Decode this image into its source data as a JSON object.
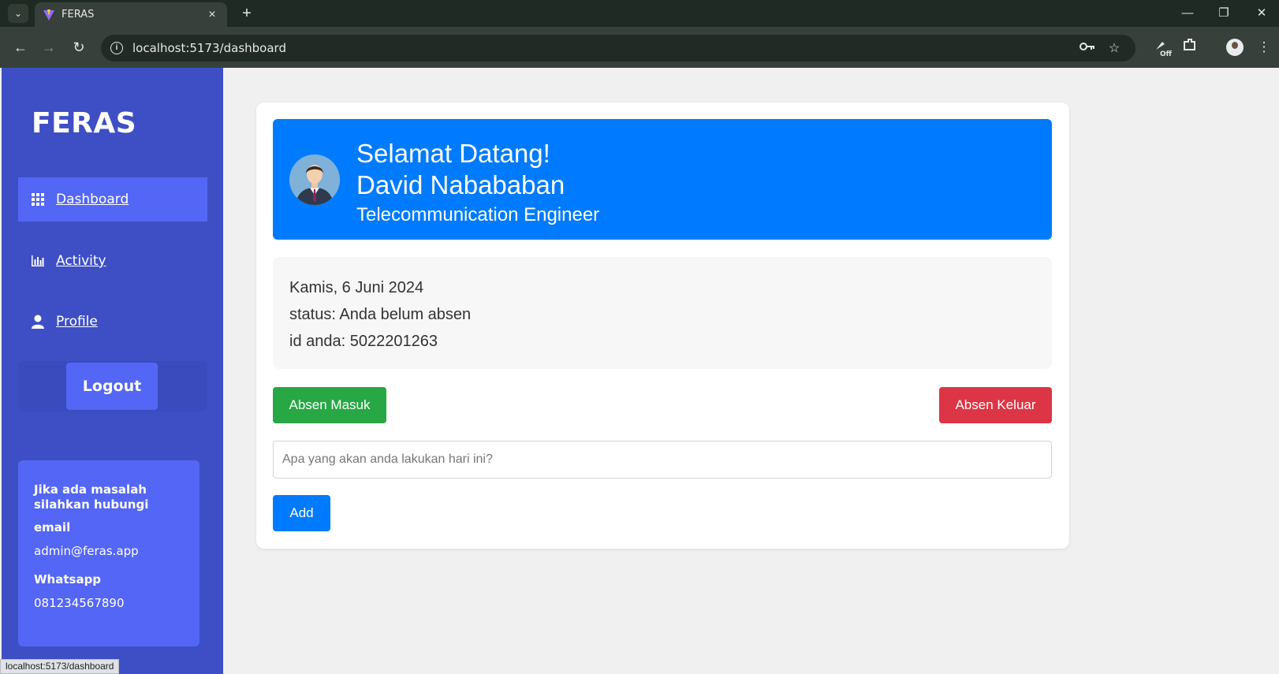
{
  "browser": {
    "tab_title": "FERAS",
    "url": "localhost:5173/dashboard",
    "status_url": "localhost:5173/dashboard",
    "extension_badge": "Off"
  },
  "sidebar": {
    "brand": "FERAS",
    "items": [
      {
        "label": "Dashboard",
        "icon": "grid-icon",
        "active": true
      },
      {
        "label": "Activity",
        "icon": "bar-chart-icon",
        "active": false
      },
      {
        "label": "Profile",
        "icon": "user-icon",
        "active": false
      }
    ],
    "logout_label": "Logout",
    "help": {
      "title": "Jika ada masalah silahkan hubungi",
      "email_label": "email",
      "email_value": "admin@feras.app",
      "whatsapp_label": "Whatsapp",
      "whatsapp_value": "081234567890"
    }
  },
  "welcome": {
    "greeting": "Selamat Datang!",
    "name": "David Nabababan",
    "role": "Telecommunication Engineer"
  },
  "info": {
    "date": "Kamis, 6 Juni 2024",
    "status": "status: Anda belum absen",
    "id": "id anda: 5022201263"
  },
  "actions": {
    "check_in": "Absen Masuk",
    "check_out": "Absen Keluar",
    "task_placeholder": "Apa yang akan anda lakukan hari ini?",
    "add": "Add"
  },
  "colors": {
    "sidebar": "#3e4fc5",
    "sidebar_active": "#5466f5",
    "primary": "#007bff",
    "success": "#28a745",
    "danger": "#dc3545"
  }
}
